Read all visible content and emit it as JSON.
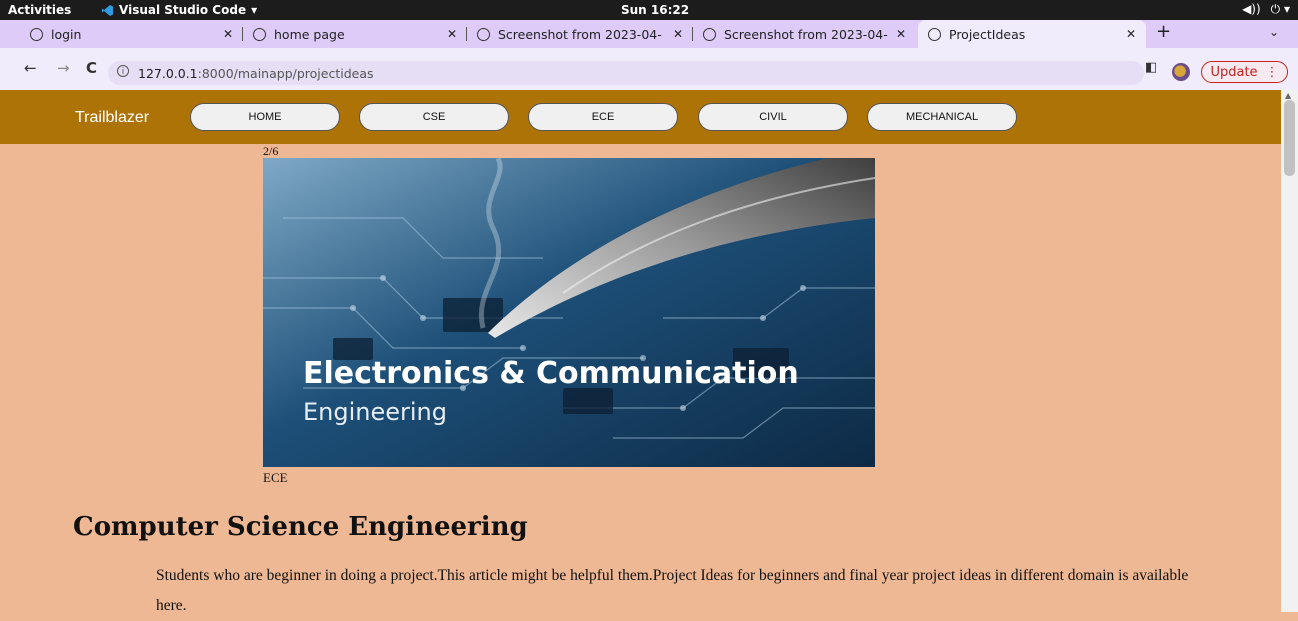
{
  "desktop": {
    "activities": "Activities",
    "app_name": "Visual Studio Code",
    "clock": "Sun 16:22"
  },
  "tabs": [
    {
      "label": "login"
    },
    {
      "label": "home page"
    },
    {
      "label": "Screenshot from 2023-04-"
    },
    {
      "label": "Screenshot from 2023-04-"
    },
    {
      "label": "ProjectIdeas",
      "active": true
    }
  ],
  "address": {
    "host": "127.0.0.1",
    "path": ":8000/mainapp/projectideas",
    "update_label": "Update"
  },
  "site": {
    "brand": "Trailblazer",
    "nav": [
      "HOME",
      "CSE",
      "ECE",
      "CIVIL",
      "MECHANICAL"
    ],
    "header_color": "#ad7307",
    "page_bg": "#efb894"
  },
  "slideshow": {
    "counter": "2/6",
    "image_title": "Electronics & Communication",
    "image_subtitle": "Engineering",
    "caption": "ECE"
  },
  "section": {
    "heading": "Computer Science Engineering",
    "body": "Students who are beginner in doing a project.This article might be helpful them.Project Ideas for beginners and final year project ideas in different domain is available here."
  }
}
